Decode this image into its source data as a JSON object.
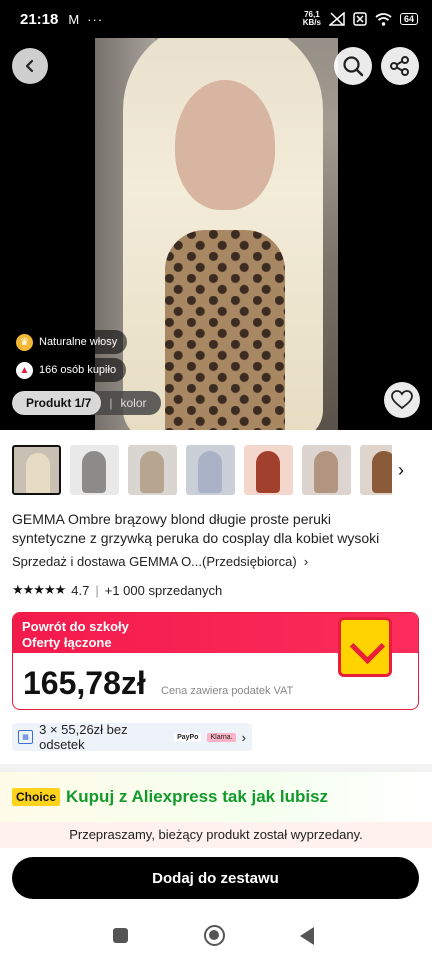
{
  "status_bar": {
    "time": "21:18",
    "mail_icon": "M",
    "dots": "···",
    "speed_value": "76,1",
    "speed_unit": "KB/s",
    "battery": "64"
  },
  "hero": {
    "badges": [
      {
        "icon": "crown-icon",
        "label": "Naturalne włosy"
      },
      {
        "icon": "flame-icon",
        "label": "166 osób kupiło"
      }
    ],
    "segment": {
      "product": "Produkt 1/7",
      "color": "kolor"
    }
  },
  "thumbnails": [
    {
      "hair": "#e6dcc4",
      "bg": "#c9c0b4"
    },
    {
      "hair": "#8d8a8a",
      "bg": "#e9e9e9"
    },
    {
      "hair": "#b7a590",
      "bg": "#d9d5d0"
    },
    {
      "hair": "#aab2c7",
      "bg": "#cbcfd8"
    },
    {
      "hair": "#a2402e",
      "bg": "#f3d6cc"
    },
    {
      "hair": "#b19580",
      "bg": "#ddd3cf"
    },
    {
      "hair": "#8b5a38",
      "bg": "#dfd5cc"
    },
    {
      "hair": "#b98e63",
      "bg": "#efe5da"
    }
  ],
  "product": {
    "title_line1": "GEMMA Ombre brązowy blond długie proste peruki",
    "title_line2": "syntetyczne z grzywką peruka do cosplay dla kobiet wysoki",
    "store": "Sprzedaż i dostawa GEMMA O...(Przedsiębiorca)",
    "stars": "★★★★★",
    "rating": "4.7",
    "sold": "+1 000 sprzedanych"
  },
  "promo": {
    "title": "Powrót do szkoły",
    "subtitle": "Oferty łączone",
    "price": "165,78zł",
    "vat_note": "Cena zawiera podatek VAT"
  },
  "installments": {
    "text": "3 × 55,26zł bez odsetek",
    "paypo": "PayPo",
    "klarna": "Klarna."
  },
  "choice": {
    "badge": "Choice",
    "text": "Kupuj z Aliexpress tak jak lubisz"
  },
  "sold_out_notice": "Przepraszamy, bieżący produkt został wyprzedany.",
  "add_button": "Dodaj do zestawu",
  "colors": {
    "accent_red": "#e3203b",
    "choice_green": "#129a2c",
    "choice_yellow": "#ffd21b"
  }
}
